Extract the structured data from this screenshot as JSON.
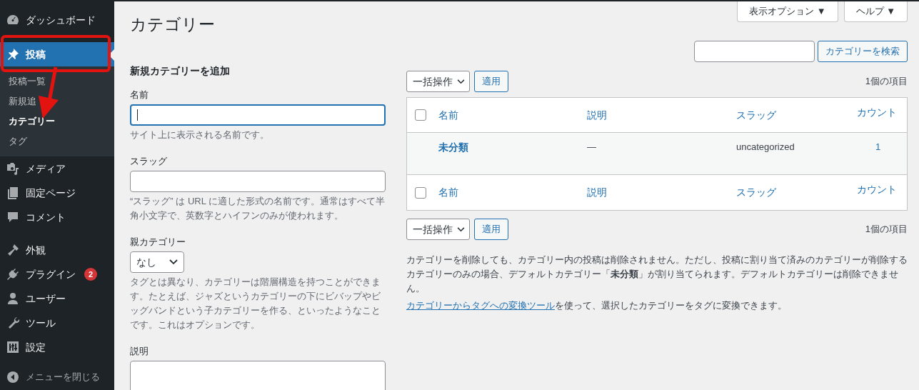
{
  "sidebar": {
    "groups": [
      [
        {
          "label": "ダッシュボード",
          "selected": false
        }
      ],
      [
        {
          "label": "投稿",
          "selected": true,
          "children": [
            {
              "label": "投稿一覧",
              "selected": false
            },
            {
              "label": "新規追",
              "selected": false
            },
            {
              "label": "カテゴリー",
              "selected": true
            },
            {
              "label": "タグ",
              "selected": false
            }
          ]
        },
        {
          "label": "メディア",
          "selected": false
        },
        {
          "label": "固定ページ",
          "selected": false
        },
        {
          "label": "コメント",
          "selected": false
        }
      ],
      [
        {
          "label": "外観",
          "selected": false
        },
        {
          "label": "プラグイン",
          "selected": false,
          "badge": "2"
        },
        {
          "label": "ユーザー",
          "selected": false
        },
        {
          "label": "ツール",
          "selected": false
        },
        {
          "label": "設定",
          "selected": false
        }
      ]
    ],
    "collapse_label": "メニューを閉じる"
  },
  "header_buttons": [
    "表示オプション ▼",
    "ヘルプ ▼"
  ],
  "page_title": "カテゴリー",
  "add_form": {
    "heading": "新規カテゴリーを追加",
    "fields": [
      {
        "kind": "text",
        "label": "名前",
        "focused": true,
        "hint": "サイト上に表示される名前です。"
      },
      {
        "kind": "text",
        "label": "スラッグ",
        "focused": false,
        "hint": "“スラッグ” は URL に適した形式の名前です。通常はすべて半角小文字で、英数字とハイフンのみが使われます。"
      },
      {
        "kind": "select",
        "label": "親カテゴリー",
        "value": "なし",
        "hint": "タグとは異なり、カテゴリーは階層構造を持つことができます。たとえば、ジャズというカテゴリーの下にビバップやビッグバンドという子カテゴリーを作る、といったようなことです。これはオプションです。"
      },
      {
        "kind": "textarea",
        "label": "説明"
      }
    ]
  },
  "search_button": "カテゴリーを検索",
  "bulk_top": {
    "select": "一括操作",
    "apply": "適用",
    "count": "1個の項目"
  },
  "table": {
    "columns": [
      "名前",
      "説明",
      "スラッグ",
      "カウント"
    ],
    "header_checked": false,
    "rows": [
      {
        "name": "未分類",
        "description": "—",
        "slug": "uncategorized",
        "count": "1"
      }
    ],
    "footer_columns": [
      "名前",
      "説明",
      "スラッグ",
      "カウント"
    ],
    "footer_checked": false
  },
  "bulk_bottom": {
    "select": "一括操作",
    "apply": "適用",
    "count": "1個の項目"
  },
  "notes": [
    {
      "text": "カテゴリーを削除しても、カテゴリー内の投稿は削除されません。ただし、投稿に割り当て済みのカテゴリーが削除するカテゴリーのみの場合、デフォルトカテゴリー「**未分類**」が割り当てられます。デフォルトカテゴリーは削除できません。"
    },
    {
      "link": "カテゴリーからタグへの変換ツール",
      "text": "を使って、選択したカテゴリーをタグに変換できます。"
    }
  ]
}
